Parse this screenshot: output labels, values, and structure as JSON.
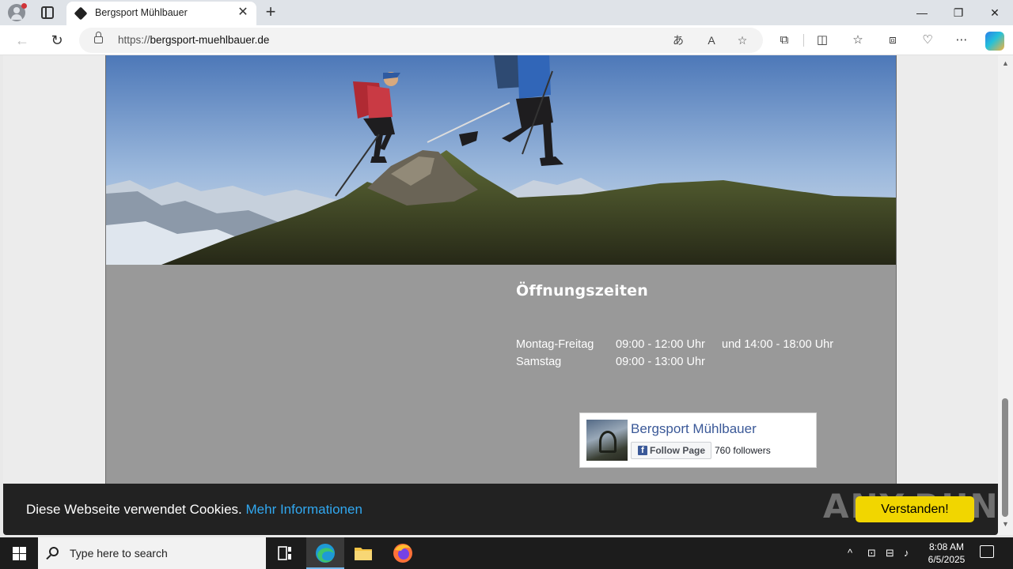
{
  "browser": {
    "tab_title": "Bergsport Mühlbauer",
    "url_prefix": "https://",
    "url_host": "bergsport-muehlbauer.de"
  },
  "hours": {
    "title": "Öffnungszeiten",
    "rows": [
      {
        "days": "Montag-Freitag",
        "morning": "09:00 - 12:00 Uhr",
        "afternoon": "und 14:00 - 18:00 Uhr"
      },
      {
        "days": "Samstag",
        "morning": "09:00 - 13:00 Uhr",
        "afternoon": ""
      }
    ]
  },
  "facebook": {
    "page_name": "Bergsport Mühlbauer",
    "follow_label": "Follow Page",
    "followers": "760 followers"
  },
  "cookie": {
    "text": "Diese Webseite verwendet Cookies.",
    "link": "Mehr Informationen",
    "button": "Verstanden!"
  },
  "watermark": "ANY.RUN",
  "taskbar": {
    "search_placeholder": "Type here to search",
    "time": "8:08 AM",
    "date": "6/5/2025"
  },
  "colors": {
    "site_bg": "#999999",
    "cookie_bar": "#222222",
    "cookie_link": "#31a8f0",
    "cookie_button": "#f1d600",
    "facebook_blue": "#3b5998"
  }
}
